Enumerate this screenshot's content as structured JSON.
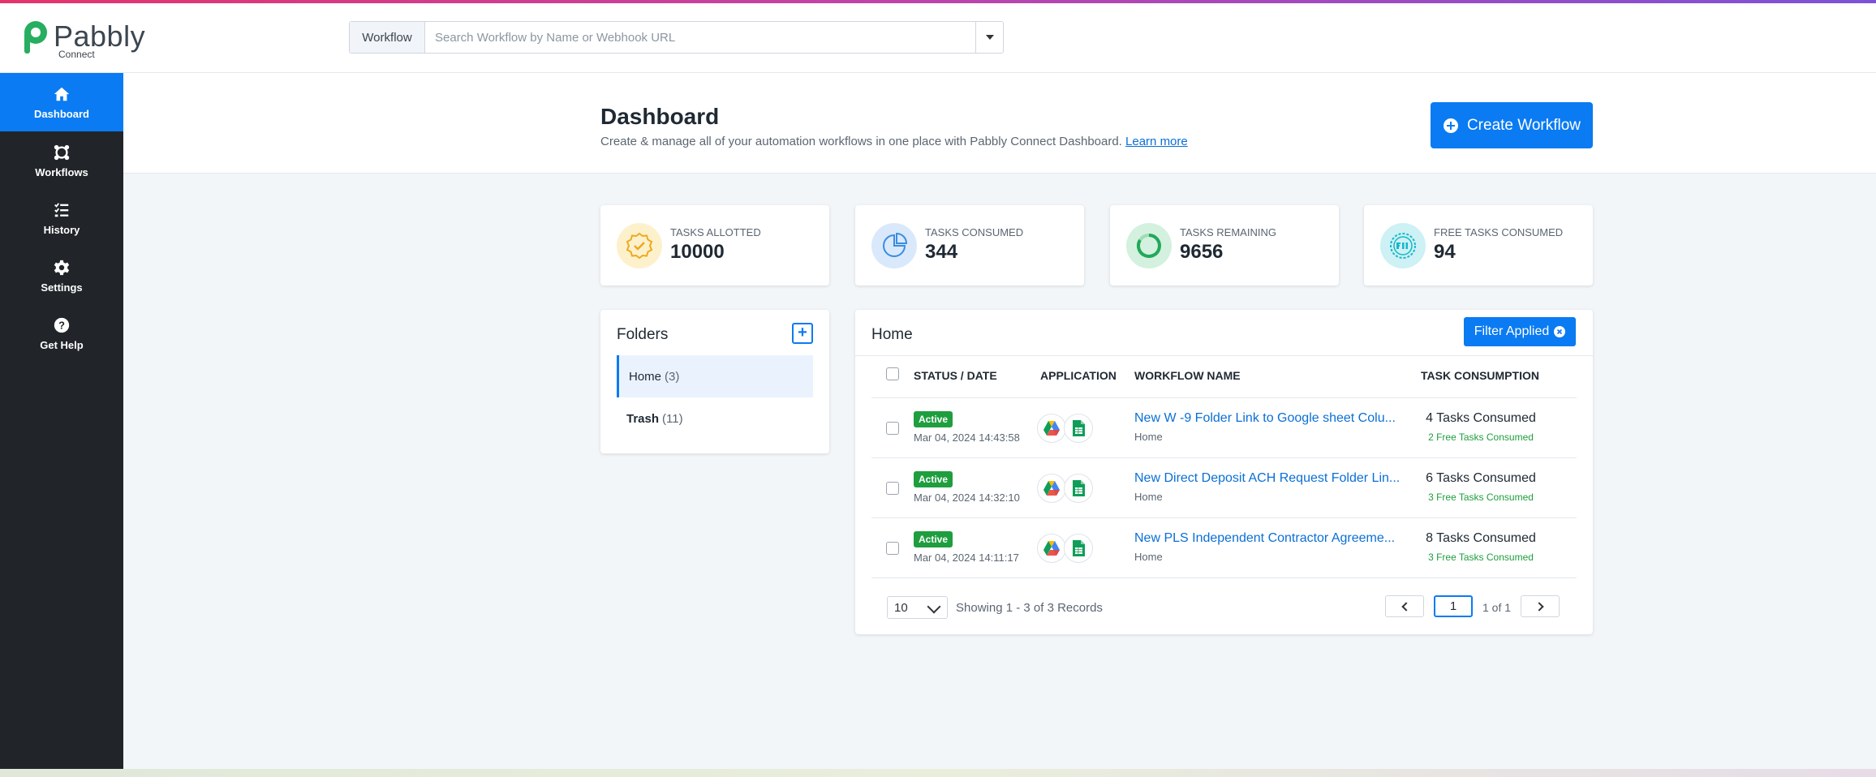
{
  "brand": {
    "name": "Pabbly",
    "sub": "Connect",
    "accent": "#0a7bf2",
    "logo_green": "#27ae60"
  },
  "search": {
    "prefix": "Workflow",
    "placeholder": "Search Workflow by Name or Webhook URL",
    "value": ""
  },
  "sidebar": {
    "items": [
      {
        "label": "Dashboard",
        "icon": "home-icon",
        "active": true
      },
      {
        "label": "Workflows",
        "icon": "workflows-icon"
      },
      {
        "label": "History",
        "icon": "history-list-icon"
      },
      {
        "label": "Settings",
        "icon": "gear-icon"
      },
      {
        "label": "Get Help",
        "icon": "question-circle-icon"
      }
    ]
  },
  "page": {
    "title": "Dashboard",
    "subtitle": "Create & manage all of your automation workflows in one place with Pabbly Connect Dashboard.",
    "learn_more": "Learn more",
    "create_button": "Create Workflow"
  },
  "stats": [
    {
      "label": "TASKS ALLOTTED",
      "value": "10000",
      "icon": "badge-check-icon",
      "color": "#f5b921"
    },
    {
      "label": "TASKS CONSUMED",
      "value": "344",
      "icon": "pie-chart-icon",
      "color": "#3a8de0"
    },
    {
      "label": "TASKS REMAINING",
      "value": "9656",
      "icon": "progress-ring-icon",
      "color": "#22a85a"
    },
    {
      "label": "FREE TASKS CONSUMED",
      "value": "94",
      "icon": "free-badge-icon",
      "color": "#14b8c9"
    }
  ],
  "folders": {
    "title": "Folders",
    "items": [
      {
        "name": "Home",
        "count": "(3)",
        "active": true
      },
      {
        "name": "Trash",
        "count": "(11)"
      }
    ]
  },
  "workflows": {
    "folder_title": "Home",
    "filter_button": "Filter Applied",
    "columns": [
      "STATUS / DATE",
      "APPLICATION",
      "WORKFLOW NAME",
      "TASK CONSUMPTION"
    ],
    "rows": [
      {
        "status": "Active",
        "date": "Mar 04, 2024 14:43:58",
        "name": "New W -9 Folder Link to Google sheet Colu...",
        "folder": "Home",
        "tasks": "4 Tasks Consumed",
        "free": "2 Free Tasks Consumed"
      },
      {
        "status": "Active",
        "date": "Mar 04, 2024 14:32:10",
        "name": "New Direct Deposit ACH Request Folder Lin...",
        "folder": "Home",
        "tasks": "6 Tasks Consumed",
        "free": "3 Free Tasks Consumed"
      },
      {
        "status": "Active",
        "date": "Mar 04, 2024 14:11:17",
        "name": "New PLS Independent Contractor Agreeme...",
        "folder": "Home",
        "tasks": "8 Tasks Consumed",
        "free": "3 Free Tasks Consumed"
      }
    ],
    "apps": [
      "google-drive-icon",
      "google-sheets-icon"
    ],
    "per_page": "10",
    "showing": "Showing 1 - 3 of 3 Records",
    "page": "1",
    "page_of": "1 of 1"
  }
}
